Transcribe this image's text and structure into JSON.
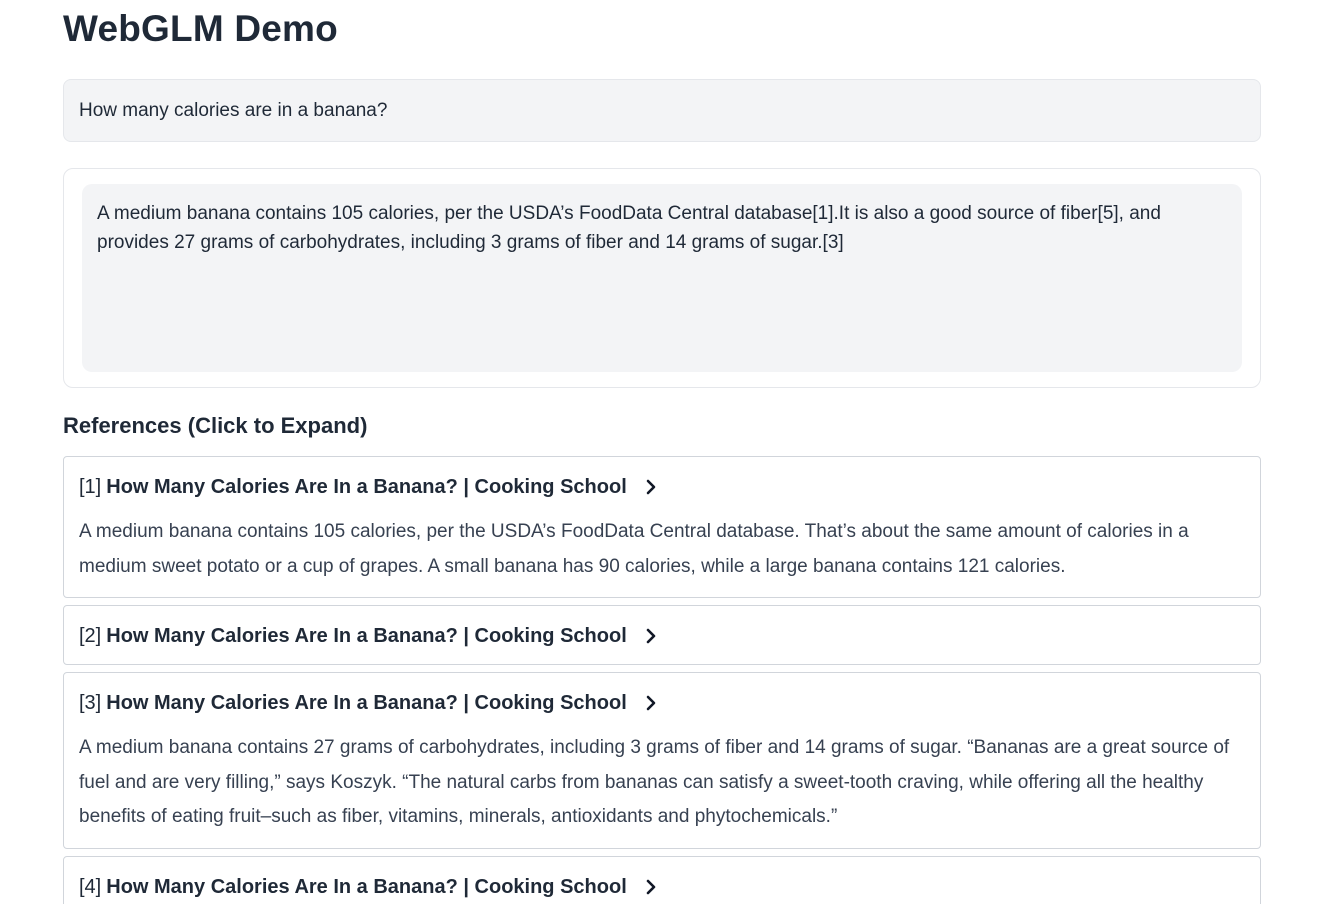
{
  "app": {
    "title": "WebGLM Demo"
  },
  "query": {
    "text": "How many calories are in a banana?"
  },
  "answer": {
    "text": "A medium banana contains 105 calories, per the USDA’s FoodData Central database[1].It is also a good source of fiber[5], and provides 27 grams of carbohydrates, including 3 grams of fiber and 14 grams of sugar.[3]"
  },
  "references": {
    "heading": "References (Click to Expand)",
    "items": [
      {
        "index": "[1]",
        "title": "How Many Calories Are In a Banana? | Cooking School",
        "expanded": true,
        "body": "A medium banana contains 105 calories, per the USDA’s FoodData Central database. That’s about the same amount of calories in a medium sweet potato or a cup of grapes. A small banana has 90 calories, while a large banana contains 121 calories.",
        "icon": "chevron-right-icon"
      },
      {
        "index": "[2]",
        "title": "How Many Calories Are In a Banana? | Cooking School",
        "expanded": false,
        "body": "",
        "icon": "chevron-right-icon"
      },
      {
        "index": "[3]",
        "title": "How Many Calories Are In a Banana? | Cooking School",
        "expanded": true,
        "body": "A medium banana contains 27 grams of carbohydrates, including 3 grams of fiber and 14 grams of sugar. “Bananas are a great source of fuel and are very filling,” says Koszyk. “The natural carbs from bananas can satisfy a sweet-tooth craving, while offering all the healthy benefits of eating fruit–such as fiber, vitamins, minerals, antioxidants and phytochemicals.”",
        "icon": "chevron-right-icon"
      },
      {
        "index": "[4]",
        "title": "How Many Calories Are In a Banana? | Cooking School",
        "expanded": false,
        "body": "",
        "icon": "chevron-right-icon"
      }
    ]
  },
  "colors": {
    "text": "#1f2937",
    "panel_bg": "#f3f4f6",
    "border": "#d1d5db"
  }
}
